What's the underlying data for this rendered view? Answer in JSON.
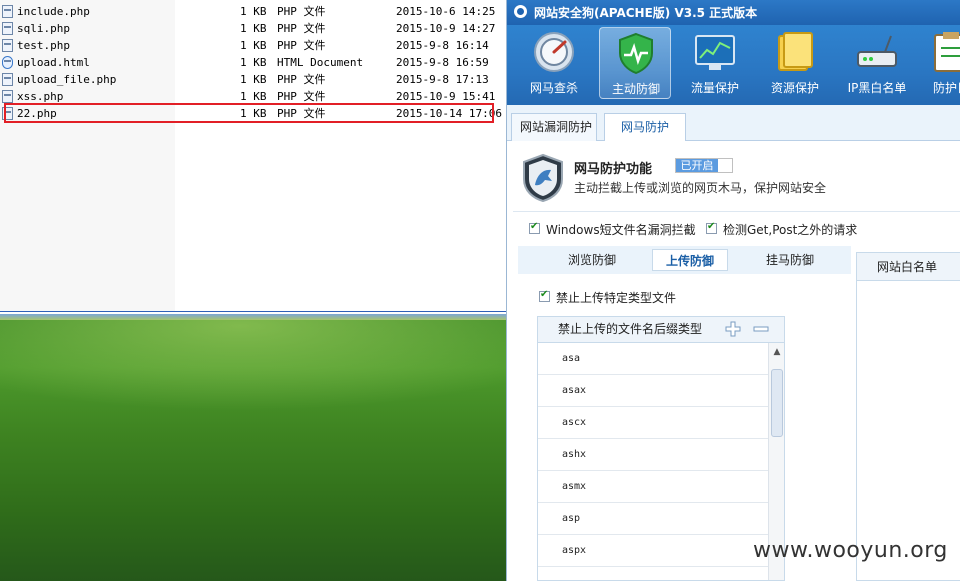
{
  "explorer": {
    "files": [
      {
        "name": "include.php",
        "size": "1 KB",
        "type": "PHP 文件",
        "modified": "2015-10-6 14:25",
        "icon": "php-file-icon"
      },
      {
        "name": "sqli.php",
        "size": "1 KB",
        "type": "PHP 文件",
        "modified": "2015-10-9 14:27",
        "icon": "php-file-icon"
      },
      {
        "name": "test.php",
        "size": "1 KB",
        "type": "PHP 文件",
        "modified": "2015-9-8 16:14",
        "icon": "php-file-icon"
      },
      {
        "name": "upload.html",
        "size": "1 KB",
        "type": "HTML Document",
        "modified": "2015-9-8 16:59",
        "icon": "html-file-icon"
      },
      {
        "name": "upload_file.php",
        "size": "1 KB",
        "type": "PHP 文件",
        "modified": "2015-9-8 17:13",
        "icon": "php-file-icon"
      },
      {
        "name": "xss.php",
        "size": "1 KB",
        "type": "PHP 文件",
        "modified": "2015-10-9 15:41",
        "icon": "php-file-icon"
      },
      {
        "name": "22.php",
        "size": "1 KB",
        "type": "PHP 文件",
        "modified": "2015-10-14 17:06",
        "icon": "php-file-icon"
      }
    ],
    "highlight_color": "#e21f26"
  },
  "app": {
    "title": "网站安全狗(APACHE版) V3.5 正式版本",
    "toolbar": [
      {
        "label": "网马查杀",
        "icon": "scan-icon"
      },
      {
        "label": "主动防御",
        "icon": "shield-icon"
      },
      {
        "label": "流量保护",
        "icon": "traffic-monitor-icon"
      },
      {
        "label": "资源保护",
        "icon": "folder-icon"
      },
      {
        "label": "IP黑白名单",
        "icon": "router-icon"
      },
      {
        "label": "防护日",
        "icon": "clipboard-icon"
      }
    ],
    "tabs": [
      {
        "label": "网站漏洞防护"
      },
      {
        "label": "网马防护"
      }
    ],
    "feature": {
      "title": "网马防护功能",
      "status": "已开启",
      "description": "主动拦截上传或浏览的网页木马，保护网站安全"
    },
    "options": [
      {
        "label": "Windows短文件名漏洞拦截",
        "checked": true
      },
      {
        "label": "检测Get,Post之外的请求",
        "checked": true
      }
    ],
    "subtabs": [
      {
        "label": "浏览防御"
      },
      {
        "label": "上传防御"
      },
      {
        "label": "挂马防御"
      }
    ],
    "upload": {
      "checkbox_label": "禁止上传特定类型文件",
      "checked": true,
      "list_header": "禁止上传的文件名后缀类型",
      "extensions": [
        "asa",
        "asax",
        "ascx",
        "ashx",
        "asmx",
        "asp",
        "aspx"
      ]
    },
    "whitelist_header": "网站白名单",
    "accent_color": "#2a76c2"
  },
  "watermark": "www.wooyun.org"
}
